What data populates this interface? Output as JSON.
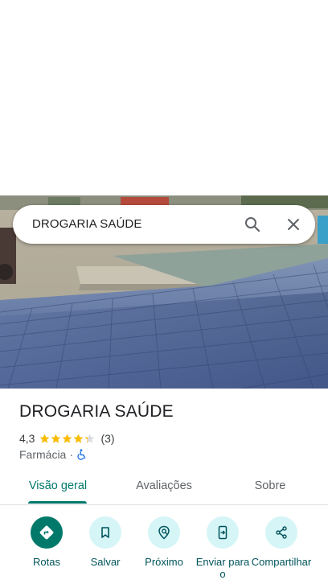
{
  "search": {
    "query": "DROGARIA SAÚDE"
  },
  "place": {
    "name": "DROGARIA SAÚDE",
    "rating": "4,3",
    "rating_stars": 4.3,
    "review_count": "(3)",
    "category": "Farmácia",
    "separator": "·"
  },
  "tabs": [
    {
      "label": "Visão geral"
    },
    {
      "label": "Avaliações"
    },
    {
      "label": "Sobre"
    }
  ],
  "actions": [
    {
      "label": "Rotas",
      "icon": "directions-icon"
    },
    {
      "label": "Salvar",
      "icon": "bookmark-icon"
    },
    {
      "label": "Próximo",
      "icon": "nearby-icon"
    },
    {
      "label": "Enviar para o",
      "icon": "send-to-phone-icon"
    },
    {
      "label": "Compartilhar",
      "icon": "share-icon"
    }
  ],
  "colors": {
    "accent": "#00796b",
    "action_bg": "#d5f5f7",
    "star": "#fbbc04",
    "accessible": "#1a73e8"
  }
}
